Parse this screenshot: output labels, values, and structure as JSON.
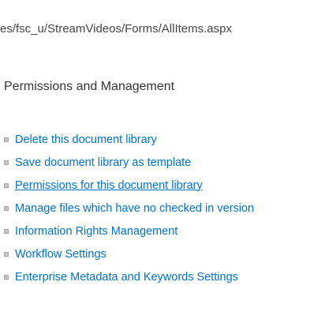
{
  "header": {
    "url_text": "es/fsc_u/StreamVideos/Forms/AllItems.aspx"
  },
  "section": {
    "title": "Permissions and Management",
    "links": [
      {
        "label": "Delete this document library"
      },
      {
        "label": "Save document library as template"
      },
      {
        "label": "Permissions for this document library",
        "hovered": true
      },
      {
        "label": "Manage files which have no checked in version"
      },
      {
        "label": "Information Rights Management"
      },
      {
        "label": "Workflow Settings"
      },
      {
        "label": "Enterprise Metadata and Keywords Settings"
      }
    ]
  },
  "colors": {
    "link": "#0072c6",
    "heading": "#333333",
    "bullet": "#c6c6c6"
  }
}
